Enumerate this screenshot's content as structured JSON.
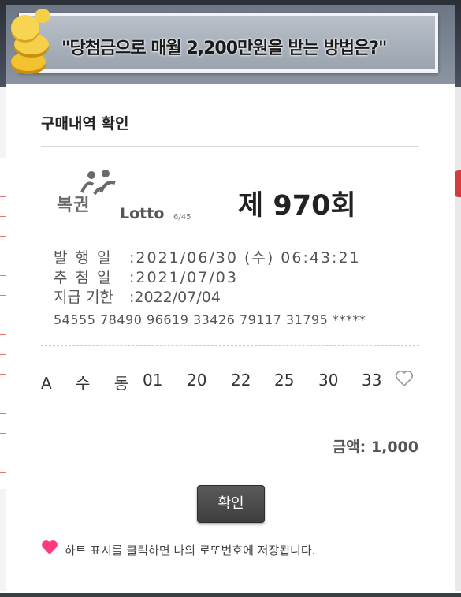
{
  "banner": {
    "text": "\"당첨금으로 매월 2,200만원을 받는 방법은?\""
  },
  "modal": {
    "title": "구매내역 확인",
    "logo": {
      "text": "복권",
      "lotto_text": "Lotto",
      "lotto_sub": "6/45"
    },
    "round": "제 970회",
    "info": {
      "issue_label": "발 행 일",
      "issue_value": ":2021/06/30 (수) 06:43:21",
      "draw_label": "추 첨 일",
      "draw_value": ":2021/07/03",
      "deadline_label": "지급 기한",
      "deadline_value": ":2022/07/04",
      "serial": "54555 78490 96619 33426 79117 31795 *****"
    },
    "game": {
      "label": "A 수 동",
      "numbers": [
        "01",
        "20",
        "22",
        "25",
        "30",
        "33"
      ]
    },
    "amount": "금액: 1,000",
    "confirm_label": "확인",
    "note": "하트 표시를 클릭하면 나의 로또번호에 저장됩니다."
  },
  "colors": {
    "heart": "#ff3b7a",
    "button": "#4a4a4a",
    "banner": "#7c8694"
  },
  "icons": [
    "coins-icon",
    "heart-outline-icon",
    "heart-filled-icon",
    "lottery-logo-icon"
  ]
}
